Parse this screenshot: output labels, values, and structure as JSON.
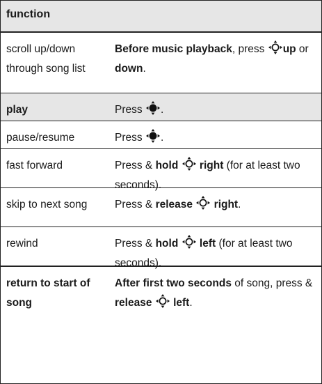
{
  "header": {
    "label": "function"
  },
  "rows": [
    {
      "func": "scroll up/down through song list",
      "func_bold": false,
      "shaded": false,
      "desc": [
        {
          "t": "Before music playback",
          "b": true
        },
        {
          "t": ", press ",
          "b": false
        },
        {
          "icon": "nav-key-icon"
        },
        {
          "t": "up",
          "b": true
        },
        {
          "t": " or ",
          "b": false
        },
        {
          "t": "down",
          "b": true
        },
        {
          "t": ".",
          "b": false
        }
      ]
    },
    {
      "func": "play",
      "func_bold": true,
      "shaded": true,
      "desc": [
        {
          "t": "Press ",
          "b": false
        },
        {
          "icon": "center-select-key-icon"
        },
        {
          "t": ".",
          "b": false
        }
      ]
    },
    {
      "func": "pause/resume",
      "func_bold": false,
      "shaded": false,
      "desc": [
        {
          "t": "Press ",
          "b": false
        },
        {
          "icon": "center-select-key-icon"
        },
        {
          "t": ".",
          "b": false
        }
      ]
    },
    {
      "func": "fast forward",
      "func_bold": false,
      "shaded": false,
      "desc": [
        {
          "t": "Press & ",
          "b": false
        },
        {
          "t": "hold",
          "b": true
        },
        {
          "t": " ",
          "b": false
        },
        {
          "icon": "nav-key-icon"
        },
        {
          "t": " ",
          "b": false
        },
        {
          "t": "right",
          "b": true
        },
        {
          "t": " (for at least two seconds).",
          "b": false
        }
      ]
    },
    {
      "func": "skip to next song",
      "func_bold": false,
      "shaded": false,
      "desc": [
        {
          "t": "Press & ",
          "b": false
        },
        {
          "t": "release",
          "b": true
        },
        {
          "t": " ",
          "b": false
        },
        {
          "icon": "nav-key-icon"
        },
        {
          "t": " ",
          "b": false
        },
        {
          "t": "right",
          "b": true
        },
        {
          "t": ".",
          "b": false
        }
      ]
    },
    {
      "func": "rewind",
      "func_bold": false,
      "shaded": false,
      "desc": [
        {
          "t": "Press & ",
          "b": false
        },
        {
          "t": "hold",
          "b": true
        },
        {
          "t": " ",
          "b": false
        },
        {
          "icon": "nav-key-icon"
        },
        {
          "t": " ",
          "b": false
        },
        {
          "t": "left",
          "b": true
        },
        {
          "t": " (for at least two seconds).",
          "b": false
        }
      ]
    },
    {
      "func": "return to start of song",
      "func_bold": true,
      "shaded": false,
      "desc": [
        {
          "t": "After first two seconds",
          "b": true
        },
        {
          "t": " of song, press & ",
          "b": false
        },
        {
          "t": "release",
          "b": true
        },
        {
          "t": " ",
          "b": false
        },
        {
          "icon": "nav-key-icon"
        },
        {
          "t": " ",
          "b": false
        },
        {
          "t": "left",
          "b": true
        },
        {
          "t": ".",
          "b": false
        }
      ]
    }
  ]
}
